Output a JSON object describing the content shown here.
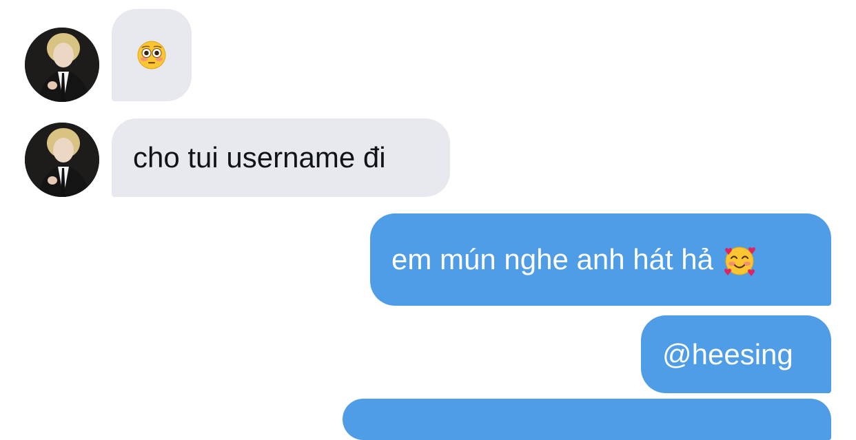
{
  "conversation": {
    "messages": [
      {
        "sender": "other",
        "text": "",
        "emoji": "flushed-face"
      },
      {
        "sender": "other",
        "text": "cho tui username đi"
      },
      {
        "sender": "me",
        "text": "em mún nghe anh hát hả",
        "emoji": "smiling-face-with-hearts"
      },
      {
        "sender": "me",
        "text": "@heesing"
      }
    ]
  },
  "colors": {
    "incoming_bubble": "#e7e9ee",
    "outgoing_bubble": "#4e9de6",
    "incoming_text": "#0f1419",
    "outgoing_text": "#ffffff"
  }
}
